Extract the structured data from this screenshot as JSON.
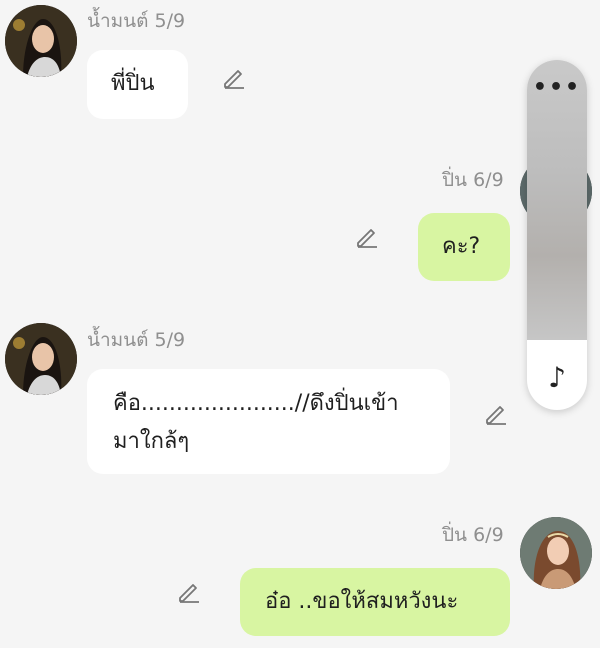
{
  "messages": [
    {
      "sender": "น้ำมนต์ 5/9",
      "text": "พี่ปิ่น"
    },
    {
      "sender": "ปิ่น 6/9",
      "text": "คะ?"
    },
    {
      "sender": "น้ำมนต์ 5/9",
      "line1": "คือ......................//ดึงปิ่นเข้า",
      "line2": "มาใกล้ๆ"
    },
    {
      "sender": "ปิ่น 6/9",
      "text": "อ๋อ ..ขอให้สมหวังนะ"
    }
  ],
  "side_panel": {
    "menu_icon": "more-dots-icon",
    "music_icon": "music-note-icon",
    "menu_glyph": "•••",
    "music_glyph": "♪"
  },
  "colors": {
    "background": "#f5f5f5",
    "incoming_bubble": "#ffffff",
    "outgoing_bubble": "#d8f5a2",
    "name_text": "#8f8f8f"
  }
}
